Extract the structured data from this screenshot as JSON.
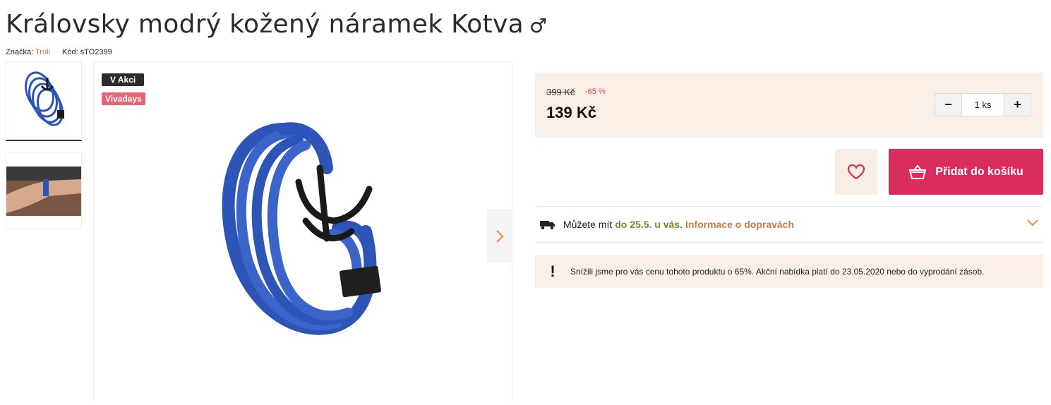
{
  "product": {
    "title": "Královsky modrý kožený náramek Kotva",
    "gender_symbol": "♂",
    "brand_label": "Značka:",
    "brand": "Troli",
    "code_label": "Kód:",
    "code": "sTO2399"
  },
  "badges": {
    "sale": "V Akci",
    "campaign": "Vivadays"
  },
  "pricing": {
    "old_price": "399 Kč",
    "discount": "-65 %",
    "price": "139 Kč"
  },
  "quantity": {
    "minus": "−",
    "value": "1 ks",
    "plus": "+"
  },
  "actions": {
    "add_to_cart": "Přidat do košíku"
  },
  "delivery": {
    "text": "Můžete mít",
    "date": "do 25.5. u vás",
    "separator": ".",
    "info_link": "Informace o dopravách"
  },
  "notice": {
    "icon": "!",
    "text": "Snížili jsme pro vás cenu tohoto produktu o 65%. Akční nabídka platí do 23.05.2020 nebo do vyprodání zásob."
  },
  "colors": {
    "accent": "#d92d5e",
    "link": "#c8794a",
    "date": "#6e8c2a",
    "panel": "#faf0e8",
    "bracelet": "#2d55b8"
  },
  "icons": {
    "wishlist": "heart-icon",
    "cart": "basket-icon",
    "delivery": "truck-icon",
    "expand": "chevron-down-icon",
    "next": "chevron-right-icon"
  }
}
